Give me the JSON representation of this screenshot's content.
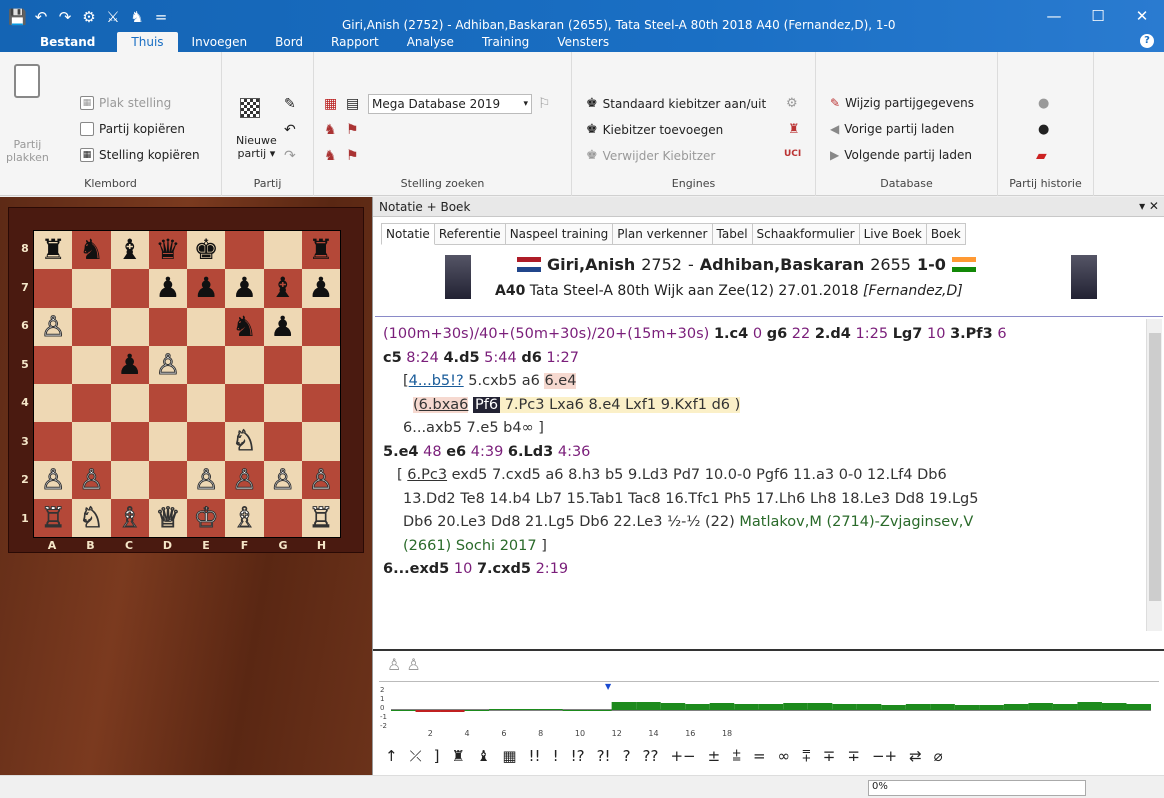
{
  "app": {
    "title": "Giri,Anish (2752) - Adhiban,Baskaran (2655), Tata Steel-A 80th 2018  A40  (Fernandez,D), 1-0"
  },
  "qat": [
    "💾",
    "↶",
    "↷",
    "⚙",
    "⚔",
    "♞",
    "="
  ],
  "winctrl": [
    "—",
    "☐",
    "✕"
  ],
  "menu": [
    "Bestand",
    "Thuis",
    "Invoegen",
    "Bord",
    "Rapport",
    "Analyse",
    "Training",
    "Vensters"
  ],
  "help": "?",
  "ribbon": {
    "klembord": {
      "label": "Klembord",
      "plakken1": "Partij",
      "plakken2": "plakken",
      "items": [
        "Plak stelling",
        "Partij kopiëren",
        "Stelling kopiëren"
      ]
    },
    "partij": {
      "label": "Partij",
      "nieuwe1": "Nieuwe",
      "nieuwe2": "partij ▾"
    },
    "zoeken": {
      "label": "Stelling zoeken",
      "db": "Mega Database 2019"
    },
    "engines": {
      "label": "Engines",
      "items": [
        "Standaard kiebitzer aan/uit",
        "Kiebitzer toevoegen",
        "Verwijder Kiebitzer"
      ],
      "uci": "UCI"
    },
    "database": {
      "label": "Database",
      "items": [
        "Wijzig partijgegevens",
        "Vorige partij laden",
        "Volgende partij laden"
      ]
    },
    "historie": {
      "label": "Partij historie"
    }
  },
  "board": {
    "ranks": [
      "8",
      "7",
      "6",
      "5",
      "4",
      "3",
      "2",
      "1"
    ],
    "files": [
      "A",
      "B",
      "C",
      "D",
      "E",
      "F",
      "G",
      "H"
    ],
    "rows": [
      [
        "♜",
        "♞",
        "♝",
        "♛",
        "♚",
        "",
        "",
        "♜"
      ],
      [
        "",
        "",
        "",
        "♟",
        "♟",
        "♟",
        "♝",
        "♟"
      ],
      [
        "♙",
        "",
        "",
        "",
        "",
        "♞",
        "♟",
        ""
      ],
      [
        "",
        "",
        "♟",
        "♙",
        "",
        "",
        "",
        ""
      ],
      [
        "",
        "",
        "",
        "",
        "",
        "",
        "",
        ""
      ],
      [
        "",
        "",
        "",
        "",
        "",
        "♘",
        "",
        ""
      ],
      [
        "♙",
        "♙",
        "",
        "",
        "♙",
        "♙",
        "♙",
        "♙"
      ],
      [
        "♖",
        "♘",
        "♗",
        "♕",
        "♔",
        "♗",
        "",
        "♖"
      ]
    ]
  },
  "pane": {
    "title": "Notatie + Boek",
    "buttons": "▾ ✕"
  },
  "tabs": [
    "Notatie",
    "Referentie",
    "Naspeel training",
    "Plan verkenner",
    "Tabel",
    "Schaakformulier",
    "Live Boek",
    "Boek"
  ],
  "game": {
    "white": "Giri,Anish",
    "welo": "2752",
    "sep": " - ",
    "black": "Adhiban,Baskaran",
    "belo": "2655",
    "result": "1-0",
    "eco": "A40",
    "event": "Tata Steel-A 80th Wijk aan Zee(12) 27.01.2018",
    "annot": "[Fernandez,D]"
  },
  "notation": {
    "l1": [
      "(100m+30s)/40+(50m+30s)/20+(15m+30s)",
      "1.c4",
      "0",
      "g6",
      "22",
      "2.d4",
      "1:25",
      "Lg7",
      "10",
      "3.Pf3",
      "6"
    ],
    "l2": [
      "c5",
      "8:24",
      "4.d5",
      "5:44",
      "d6",
      "1:27"
    ],
    "l3": [
      "[",
      "4...b5!?",
      "5.cxb5",
      "a6",
      "6.e4"
    ],
    "l4": [
      "(",
      "6.bxa6",
      "Pf6",
      "7.Pc3",
      "Lxa6",
      "8.e4",
      "Lxf1",
      "9.Kxf1",
      "d6",
      ")"
    ],
    "l5": "6...axb5  7.e5  b4∞ ]",
    "l6": [
      "5.e4",
      "48",
      "e6",
      "4:39",
      "6.Ld3",
      "4:36"
    ],
    "l7a": "[ ",
    "l7b": "6.Pc3",
    "l7c": " exd5 7.cxd5 a6 8.h3 b5 9.Ld3 Pd7 10.0-0 Pgf6 11.a3 0-0 12.Lf4 Db6",
    "l8": "13.Dd2 Te8 14.b4 Lb7 15.Tab1 Tac8 16.Tfc1 Ph5 17.Lh6 Lh8 18.Le3 Dd8 19.Lg5",
    "l9a": "Db6 20.Le3 Dd8 21.Lg5 Db6 22.Le3 ½-½ (22) ",
    "l9b": "Matlakov,M (2714)-Zvjaginsev,V",
    "l10a": "(2661) Sochi 2017",
    "l10b": " ]",
    "l11": [
      "6...exd5",
      "10",
      "7.cxd5",
      "2:19"
    ]
  },
  "eval": {
    "ticks": [
      "2",
      "4",
      "6",
      "8",
      "10",
      "12",
      "14",
      "16",
      "18"
    ],
    "ylabels": [
      "2",
      "1",
      "0",
      "-1",
      "-2"
    ],
    "values": [
      0.0,
      -0.2,
      -0.2,
      0.0,
      0.1,
      0.1,
      0.1,
      0.0,
      0.0,
      0.8,
      0.8,
      0.7,
      0.6,
      0.7,
      0.6,
      0.6,
      0.7,
      0.7,
      0.6,
      0.6,
      0.5,
      0.6,
      0.6,
      0.5,
      0.5,
      0.6,
      0.7,
      0.6,
      0.8,
      0.7,
      0.6
    ]
  },
  "symbols": [
    "↑",
    "⤫",
    "]",
    "♜",
    "♝",
    "▦",
    "!!",
    "!",
    "!?",
    "?!",
    "?",
    "??",
    "+−",
    "±",
    "⩲",
    "=",
    "∞",
    "⩱",
    "∓",
    "∓",
    "−+",
    "⇄",
    "⌀"
  ],
  "pieces_row": "♙ ♙",
  "status": {
    "progress": "0%"
  }
}
